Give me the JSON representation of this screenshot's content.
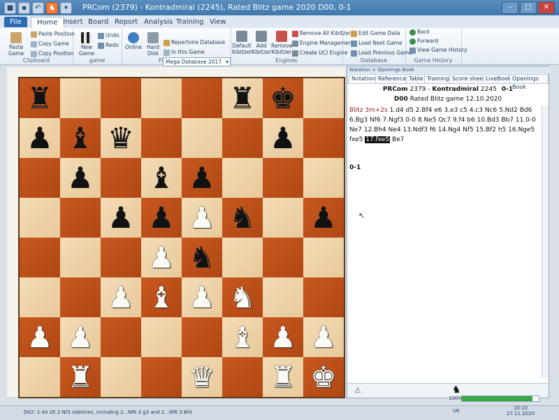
{
  "window": {
    "title": "PRCom (2379) - Kontradmiral (2245), Rated Blitz game 2020  D00, 0-1"
  },
  "ribbon_tabs": [
    "File",
    "Home",
    "Insert",
    "Board",
    "Report",
    "Analysis",
    "Training",
    "View"
  ],
  "clipboard": {
    "paste": "Paste Game",
    "paste_position": "Paste Position",
    "copy_game": "Copy Game",
    "copy_position": "Copy Position",
    "label": "Clipboard"
  },
  "game_group": {
    "new_game": "New Game",
    "undo": "Undo",
    "redo": "Redo",
    "label": "game"
  },
  "find_position": {
    "online": "Online",
    "hard_disk": "Hard Disk",
    "database": "Mega Database 2017",
    "repertoire": "Repertoire Database",
    "in_this_game": "In this Game",
    "label": "Find Position"
  },
  "engines": {
    "default": "Default Kibitzer",
    "add": "Add Kibitzer",
    "remove": "Remove Kibitzer",
    "remove_all": "Remove All Kibitzers",
    "management": "Engine Management",
    "create_uci": "Create UCI Engine",
    "label": "Engines"
  },
  "database_group": {
    "edit": "Edit Game Data",
    "load_next": "Load Next Game",
    "load_prev": "Load Previous Game",
    "label": "Database"
  },
  "history": {
    "back": "Back",
    "forward": "Forward",
    "view": "View Game History",
    "label": "Game History"
  },
  "panel": {
    "title": "Notation × Openings Book",
    "tabs": [
      "Notation",
      "Reference",
      "Table",
      "Training",
      "Score sheet",
      "LiveBook",
      "Openings Book"
    ],
    "white_player": "PRCom",
    "white_elo": "2379",
    "black_player": "Kontradmiral",
    "black_elo": "2245",
    "result_header": "0-1",
    "eco": "D00",
    "event": "Rated Blitz game 12.10.2020",
    "time_control": "Blitz 3m+2s",
    "moves_text": "1.d4 d5 2.Bf4 e6 3.e3 c5 4.c3 Nc6 5.Nd2 Bd6 6.Bg3 Nf6 7.Ngf3 0-0 8.Ne5 Qc7 9.f4 b6 10.Bd3 Bb7 11.0-0 Ne7 12.Bh4 Ne4 13.Ndf3 f6 14.Ng4 Nf5 15.Bf2 h5 16.Nge5 fxe5",
    "current_move": "17.fxe5",
    "after_move": "Be7",
    "result": "0-1"
  },
  "status": {
    "text": "D02: 1 d4 d5 2 Nf3 sidelines, including 2...Nf6 3 g3 and 2...Nf6 3 Bf4",
    "zoom": "100%",
    "progress": 0.92,
    "language": "UK",
    "time": "10:10",
    "date": "27.11.2020"
  },
  "board": {
    "orientation": "black-bottom",
    "pieces": [
      {
        "sq": "a8",
        "glyph": "♚",
        "color": "w",
        "name": "white-king"
      },
      {
        "sq": "b8",
        "glyph": "♜",
        "color": "w",
        "name": "white-rook"
      },
      {
        "sq": "d8",
        "glyph": "♛",
        "color": "w",
        "name": "white-queen"
      },
      {
        "sq": "g8",
        "glyph": "♜",
        "color": "w",
        "name": "white-rook"
      },
      {
        "sq": "a7",
        "glyph": "♟",
        "color": "w",
        "name": "white-pawn"
      },
      {
        "sq": "b7",
        "glyph": "♟",
        "color": "w",
        "name": "white-pawn"
      },
      {
        "sq": "c7",
        "glyph": "♝",
        "color": "w",
        "name": "white-bishop"
      },
      {
        "sq": "g7",
        "glyph": "♟",
        "color": "w",
        "name": "white-pawn"
      },
      {
        "sq": "h7",
        "glyph": "♟",
        "color": "w",
        "name": "white-pawn"
      },
      {
        "sq": "c6",
        "glyph": "♞",
        "color": "w",
        "name": "white-knight"
      },
      {
        "sq": "d6",
        "glyph": "♟",
        "color": "w",
        "name": "white-pawn"
      },
      {
        "sq": "e6",
        "glyph": "♝",
        "color": "w",
        "name": "white-bishop"
      },
      {
        "sq": "f6",
        "glyph": "♟",
        "color": "w",
        "name": "white-pawn"
      },
      {
        "sq": "d5",
        "glyph": "♞",
        "color": "b",
        "name": "black-knight"
      },
      {
        "sq": "e5",
        "glyph": "♟",
        "color": "w",
        "name": "white-pawn"
      },
      {
        "sq": "a4",
        "glyph": "♟",
        "color": "b",
        "name": "black-pawn"
      },
      {
        "sq": "c4",
        "glyph": "♞",
        "color": "b",
        "name": "black-knight"
      },
      {
        "sq": "d4",
        "glyph": "♟",
        "color": "w",
        "name": "white-pawn"
      },
      {
        "sq": "e4",
        "glyph": "♟",
        "color": "b",
        "name": "black-pawn"
      },
      {
        "sq": "f4",
        "glyph": "♟",
        "color": "b",
        "name": "black-pawn"
      },
      {
        "sq": "d3",
        "glyph": "♟",
        "color": "b",
        "name": "black-pawn"
      },
      {
        "sq": "e3",
        "glyph": "♝",
        "color": "b",
        "name": "black-bishop"
      },
      {
        "sq": "g3",
        "glyph": "♟",
        "color": "b",
        "name": "black-pawn"
      },
      {
        "sq": "b2",
        "glyph": "♟",
        "color": "b",
        "name": "black-pawn"
      },
      {
        "sq": "f2",
        "glyph": "♛",
        "color": "b",
        "name": "black-queen"
      },
      {
        "sq": "g2",
        "glyph": "♝",
        "color": "b",
        "name": "black-bishop"
      },
      {
        "sq": "h2",
        "glyph": "♟",
        "color": "b",
        "name": "black-pawn"
      },
      {
        "sq": "b1",
        "glyph": "♚",
        "color": "b",
        "name": "black-king"
      },
      {
        "sq": "c1",
        "glyph": "♜",
        "color": "b",
        "name": "black-rook"
      },
      {
        "sq": "h1",
        "glyph": "♜",
        "color": "b",
        "name": "black-rook"
      }
    ]
  },
  "colors": {
    "light_square": "#f3dcb7",
    "dark_square": "#c8581f",
    "file_tab": "#2a6db5",
    "progress": "#3aa845"
  }
}
